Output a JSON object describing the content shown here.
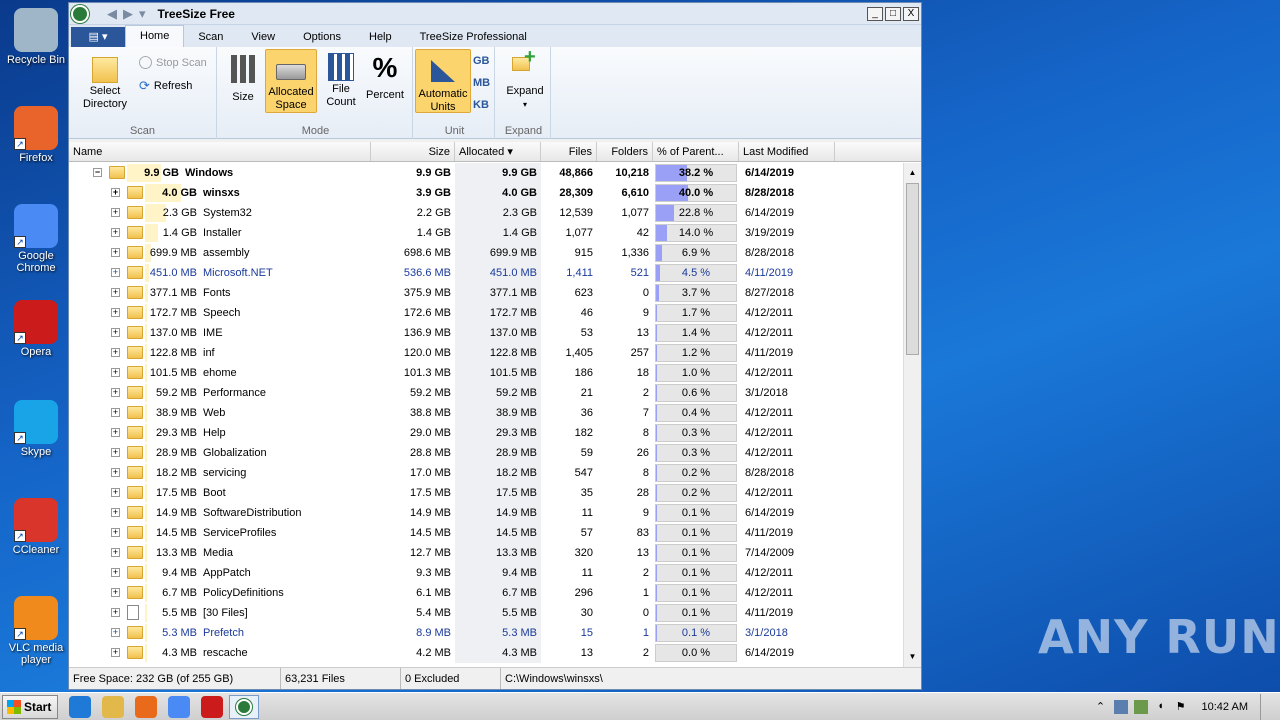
{
  "desktop": {
    "icons": [
      {
        "label": "Recycle Bin",
        "color": "#9fb6c9"
      },
      {
        "label": "Firefox",
        "color": "#e8642a"
      },
      {
        "label": "Google Chrome",
        "color": "#4a8af4"
      },
      {
        "label": "Opera",
        "color": "#cc1b1b"
      },
      {
        "label": "Skype",
        "color": "#1aa4e8"
      },
      {
        "label": "CCleaner",
        "color": "#d9352b"
      },
      {
        "label": "VLC media player",
        "color": "#f08a1c"
      }
    ],
    "watermark": "ANY RUN"
  },
  "window": {
    "title": "TreeSize Free",
    "controls": {
      "minimize": "_",
      "maximize": "□",
      "close": "X"
    }
  },
  "ribbon_tabs": [
    "Home",
    "Scan",
    "View",
    "Options",
    "Help",
    "TreeSize Professional"
  ],
  "ribbon": {
    "scan_group": {
      "label": "Scan",
      "select_directory": "Select Directory",
      "stop_scan": "Stop Scan",
      "refresh": "Refresh"
    },
    "mode_group": {
      "label": "Mode",
      "size": "Size",
      "allocated_space": "Allocated Space",
      "file_count": "File Count",
      "percent": "Percent",
      "percent_symbol": "%"
    },
    "unit_group": {
      "label": "Unit",
      "automatic_units": "Automatic Units",
      "gb": "GB",
      "mb": "MB",
      "kb": "KB"
    },
    "expand_group": {
      "label": "Expand",
      "expand": "Expand"
    }
  },
  "columns": {
    "name": "Name",
    "size": "Size",
    "allocated": "Allocated",
    "files": "Files",
    "folders": "Folders",
    "percent_of_parent": "% of Parent...",
    "last_modified": "Last Modified"
  },
  "rows": [
    {
      "level": 0,
      "bar": "9.9 GB",
      "name": "Windows",
      "size": "9.9 GB",
      "allocated": "9.9 GB",
      "files": "48,866",
      "folders": "10,218",
      "pct": "38.2 %",
      "pct_value": 38.2,
      "modified": "6/14/2019",
      "bold": true,
      "blue": false,
      "icon": "folder",
      "expanded": true
    },
    {
      "level": 1,
      "bar": "4.0 GB",
      "name": "winsxs",
      "size": "3.9 GB",
      "allocated": "4.0 GB",
      "files": "28,309",
      "folders": "6,610",
      "pct": "40.0 %",
      "pct_value": 40.0,
      "modified": "8/28/2018",
      "bold": true,
      "blue": false,
      "icon": "folder"
    },
    {
      "level": 1,
      "bar": "2.3 GB",
      "name": "System32",
      "size": "2.2 GB",
      "allocated": "2.3 GB",
      "files": "12,539",
      "folders": "1,077",
      "pct": "22.8 %",
      "pct_value": 22.8,
      "modified": "6/14/2019",
      "bold": false,
      "blue": false,
      "icon": "folder"
    },
    {
      "level": 1,
      "bar": "1.4 GB",
      "name": "Installer",
      "size": "1.4 GB",
      "allocated": "1.4 GB",
      "files": "1,077",
      "folders": "42",
      "pct": "14.0 %",
      "pct_value": 14.0,
      "modified": "3/19/2019",
      "bold": false,
      "blue": false,
      "icon": "folder"
    },
    {
      "level": 1,
      "bar": "699.9 MB",
      "name": "assembly",
      "size": "698.6 MB",
      "allocated": "699.9 MB",
      "files": "915",
      "folders": "1,336",
      "pct": "6.9 %",
      "pct_value": 6.9,
      "modified": "8/28/2018",
      "bold": false,
      "blue": false,
      "icon": "folder"
    },
    {
      "level": 1,
      "bar": "451.0 MB",
      "name": "Microsoft.NET",
      "size": "536.6 MB",
      "allocated": "451.0 MB",
      "files": "1,411",
      "folders": "521",
      "pct": "4.5 %",
      "pct_value": 4.5,
      "modified": "4/11/2019",
      "bold": false,
      "blue": true,
      "icon": "folder"
    },
    {
      "level": 1,
      "bar": "377.1 MB",
      "name": "Fonts",
      "size": "375.9 MB",
      "allocated": "377.1 MB",
      "files": "623",
      "folders": "0",
      "pct": "3.7 %",
      "pct_value": 3.7,
      "modified": "8/27/2018",
      "bold": false,
      "blue": false,
      "icon": "folder"
    },
    {
      "level": 1,
      "bar": "172.7 MB",
      "name": "Speech",
      "size": "172.6 MB",
      "allocated": "172.7 MB",
      "files": "46",
      "folders": "9",
      "pct": "1.7 %",
      "pct_value": 1.7,
      "modified": "4/12/2011",
      "bold": false,
      "blue": false,
      "icon": "folder"
    },
    {
      "level": 1,
      "bar": "137.0 MB",
      "name": "IME",
      "size": "136.9 MB",
      "allocated": "137.0 MB",
      "files": "53",
      "folders": "13",
      "pct": "1.4 %",
      "pct_value": 1.4,
      "modified": "4/12/2011",
      "bold": false,
      "blue": false,
      "icon": "folder"
    },
    {
      "level": 1,
      "bar": "122.8 MB",
      "name": "inf",
      "size": "120.0 MB",
      "allocated": "122.8 MB",
      "files": "1,405",
      "folders": "257",
      "pct": "1.2 %",
      "pct_value": 1.2,
      "modified": "4/11/2019",
      "bold": false,
      "blue": false,
      "icon": "folder"
    },
    {
      "level": 1,
      "bar": "101.5 MB",
      "name": "ehome",
      "size": "101.3 MB",
      "allocated": "101.5 MB",
      "files": "186",
      "folders": "18",
      "pct": "1.0 %",
      "pct_value": 1.0,
      "modified": "4/12/2011",
      "bold": false,
      "blue": false,
      "icon": "folder"
    },
    {
      "level": 1,
      "bar": "59.2 MB",
      "name": "Performance",
      "size": "59.2 MB",
      "allocated": "59.2 MB",
      "files": "21",
      "folders": "2",
      "pct": "0.6 %",
      "pct_value": 0.6,
      "modified": "3/1/2018",
      "bold": false,
      "blue": false,
      "icon": "folder"
    },
    {
      "level": 1,
      "bar": "38.9 MB",
      "name": "Web",
      "size": "38.8 MB",
      "allocated": "38.9 MB",
      "files": "36",
      "folders": "7",
      "pct": "0.4 %",
      "pct_value": 0.4,
      "modified": "4/12/2011",
      "bold": false,
      "blue": false,
      "icon": "folder"
    },
    {
      "level": 1,
      "bar": "29.3 MB",
      "name": "Help",
      "size": "29.0 MB",
      "allocated": "29.3 MB",
      "files": "182",
      "folders": "8",
      "pct": "0.3 %",
      "pct_value": 0.3,
      "modified": "4/12/2011",
      "bold": false,
      "blue": false,
      "icon": "folder"
    },
    {
      "level": 1,
      "bar": "28.9 MB",
      "name": "Globalization",
      "size": "28.8 MB",
      "allocated": "28.9 MB",
      "files": "59",
      "folders": "26",
      "pct": "0.3 %",
      "pct_value": 0.3,
      "modified": "4/12/2011",
      "bold": false,
      "blue": false,
      "icon": "folder"
    },
    {
      "level": 1,
      "bar": "18.2 MB",
      "name": "servicing",
      "size": "17.0 MB",
      "allocated": "18.2 MB",
      "files": "547",
      "folders": "8",
      "pct": "0.2 %",
      "pct_value": 0.2,
      "modified": "8/28/2018",
      "bold": false,
      "blue": false,
      "icon": "folder"
    },
    {
      "level": 1,
      "bar": "17.5 MB",
      "name": "Boot",
      "size": "17.5 MB",
      "allocated": "17.5 MB",
      "files": "35",
      "folders": "28",
      "pct": "0.2 %",
      "pct_value": 0.2,
      "modified": "4/12/2011",
      "bold": false,
      "blue": false,
      "icon": "folder"
    },
    {
      "level": 1,
      "bar": "14.9 MB",
      "name": "SoftwareDistribution",
      "size": "14.9 MB",
      "allocated": "14.9 MB",
      "files": "11",
      "folders": "9",
      "pct": "0.1 %",
      "pct_value": 0.1,
      "modified": "6/14/2019",
      "bold": false,
      "blue": false,
      "icon": "folder"
    },
    {
      "level": 1,
      "bar": "14.5 MB",
      "name": "ServiceProfiles",
      "size": "14.5 MB",
      "allocated": "14.5 MB",
      "files": "57",
      "folders": "83",
      "pct": "0.1 %",
      "pct_value": 0.1,
      "modified": "4/11/2019",
      "bold": false,
      "blue": false,
      "icon": "folder"
    },
    {
      "level": 1,
      "bar": "13.3 MB",
      "name": "Media",
      "size": "12.7 MB",
      "allocated": "13.3 MB",
      "files": "320",
      "folders": "13",
      "pct": "0.1 %",
      "pct_value": 0.1,
      "modified": "7/14/2009",
      "bold": false,
      "blue": false,
      "icon": "folder"
    },
    {
      "level": 1,
      "bar": "9.4 MB",
      "name": "AppPatch",
      "size": "9.3 MB",
      "allocated": "9.4 MB",
      "files": "11",
      "folders": "2",
      "pct": "0.1 %",
      "pct_value": 0.1,
      "modified": "4/12/2011",
      "bold": false,
      "blue": false,
      "icon": "folder"
    },
    {
      "level": 1,
      "bar": "6.7 MB",
      "name": "PolicyDefinitions",
      "size": "6.1 MB",
      "allocated": "6.7 MB",
      "files": "296",
      "folders": "1",
      "pct": "0.1 %",
      "pct_value": 0.1,
      "modified": "4/12/2011",
      "bold": false,
      "blue": false,
      "icon": "folder"
    },
    {
      "level": 1,
      "bar": "5.5 MB",
      "name": "[30 Files]",
      "size": "5.4 MB",
      "allocated": "5.5 MB",
      "files": "30",
      "folders": "0",
      "pct": "0.1 %",
      "pct_value": 0.1,
      "modified": "4/11/2019",
      "bold": false,
      "blue": false,
      "icon": "file"
    },
    {
      "level": 1,
      "bar": "5.3 MB",
      "name": "Prefetch",
      "size": "8.9 MB",
      "allocated": "5.3 MB",
      "files": "15",
      "folders": "1",
      "pct": "0.1 %",
      "pct_value": 0.1,
      "modified": "3/1/2018",
      "bold": false,
      "blue": true,
      "icon": "folder"
    },
    {
      "level": 1,
      "bar": "4.3 MB",
      "name": "rescache",
      "size": "4.2 MB",
      "allocated": "4.3 MB",
      "files": "13",
      "folders": "2",
      "pct": "0.0 %",
      "pct_value": 0.0,
      "modified": "6/14/2019",
      "bold": false,
      "blue": false,
      "icon": "folder"
    }
  ],
  "status": {
    "free_space": "Free Space: 232 GB  (of 255 GB)",
    "files": "63,231  Files",
    "excluded": "0 Excluded",
    "path": "C:\\Windows\\winsxs\\"
  },
  "taskbar": {
    "start": "Start",
    "clock": "10:42 AM",
    "pinned": [
      {
        "name": "ie-icon",
        "color": "#1e7ad6"
      },
      {
        "name": "explorer-icon",
        "color": "#e2b84a"
      },
      {
        "name": "media-player-icon",
        "color": "#e86a1a"
      },
      {
        "name": "chrome-icon",
        "color": "#4a8af4"
      },
      {
        "name": "opera-icon",
        "color": "#cc1b1b"
      }
    ]
  }
}
